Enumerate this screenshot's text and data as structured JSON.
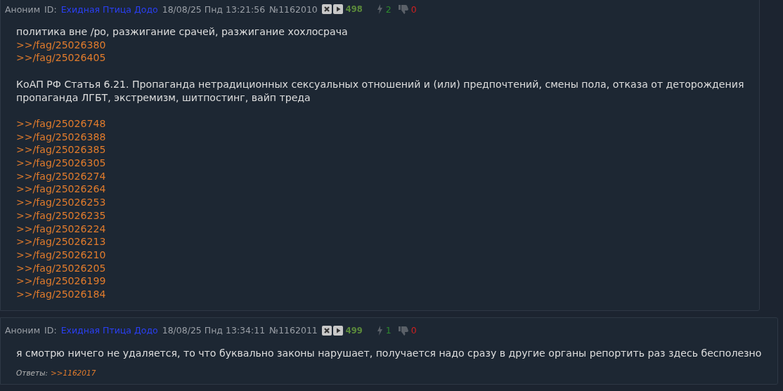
{
  "posts": [
    {
      "author": "Аноним",
      "id_label": "ID:",
      "id_name": "Ехидная Птица Додо",
      "date": "18/08/25 Пнд 13:21:56",
      "number": "№1162010",
      "index": "498",
      "likes": "2",
      "dislikes": "0",
      "wide": false,
      "paragraphs": [
        [
          {
            "kind": "text",
            "text": "политика вне /ро, разжигание срачей, разжигание хохлосрача"
          },
          {
            "kind": "link",
            "text": ">>/fag/25026380"
          },
          {
            "kind": "link",
            "text": ">>/fag/25026405"
          }
        ],
        [
          {
            "kind": "text",
            "text": "КоАП РФ Статья 6.21. Пропаганда нетрадиционных сексуальных отношений и (или) предпочтений, смены пола, отказа от деторождения"
          },
          {
            "kind": "text",
            "text": "пропаганда ЛГБТ, экстремизм, шитпостинг, вайп треда"
          }
        ],
        [
          {
            "kind": "link",
            "text": ">>/fag/25026748"
          },
          {
            "kind": "link",
            "text": ">>/fag/25026388"
          },
          {
            "kind": "link",
            "text": ">>/fag/25026385"
          },
          {
            "kind": "link",
            "text": ">>/fag/25026305"
          },
          {
            "kind": "link",
            "text": ">>/fag/25026274"
          },
          {
            "kind": "link",
            "text": ">>/fag/25026264"
          },
          {
            "kind": "link",
            "text": ">>/fag/25026253"
          },
          {
            "kind": "link",
            "text": ">>/fag/25026235"
          },
          {
            "kind": "link",
            "text": ">>/fag/25026224"
          },
          {
            "kind": "link",
            "text": ">>/fag/25026213"
          },
          {
            "kind": "link",
            "text": ">>/fag/25026210"
          },
          {
            "kind": "link",
            "text": ">>/fag/25026205"
          },
          {
            "kind": "link",
            "text": ">>/fag/25026199"
          },
          {
            "kind": "link",
            "text": ">>/fag/25026184"
          }
        ]
      ]
    },
    {
      "author": "Аноним",
      "id_label": "ID:",
      "id_name": "Ехидная Птица Додо",
      "date": "18/08/25 Пнд 13:34:11",
      "number": "№1162011",
      "index": "499",
      "likes": "1",
      "dislikes": "0",
      "wide": true,
      "paragraphs": [
        [
          {
            "kind": "text",
            "text": "я смотрю ничего не удаляется, то что буквально законы нарушает, получается надо сразу в другие органы репортить раз здесь бесполезно"
          }
        ]
      ],
      "replies_label": "Ответы:",
      "replies": [
        ">>1162017"
      ]
    }
  ]
}
